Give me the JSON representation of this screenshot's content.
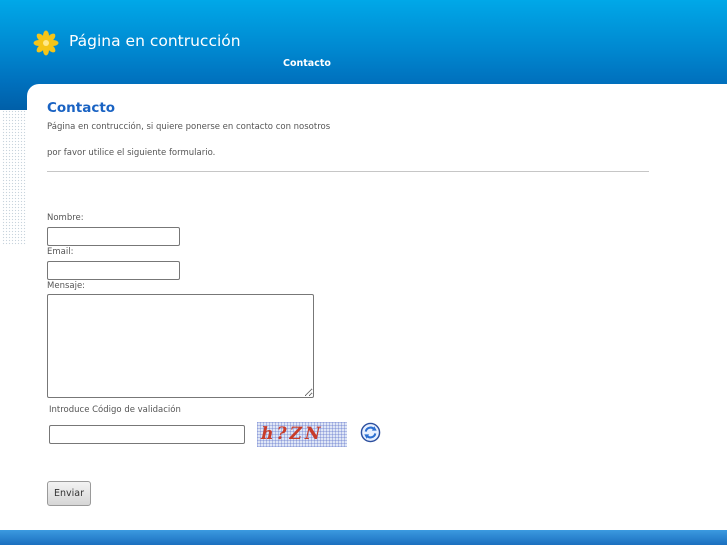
{
  "site": {
    "title": "Página en contrucción"
  },
  "nav": {
    "items": [
      {
        "label": "Contacto"
      }
    ]
  },
  "page": {
    "heading": "Contacto",
    "intro_line1": "Página en contrucción, si quiere ponerse en contacto con nosotros",
    "intro_line2": "por favor utilice el siguiente formulario."
  },
  "form": {
    "name_label": "Nombre:",
    "name_value": "",
    "email_label": "Email:",
    "email_value": "",
    "message_label": "Mensaje:",
    "message_value": "",
    "captcha_label": "Introduce Código de validación",
    "captcha_value": "",
    "captcha_text": "h?ZN",
    "refresh_icon": "refresh-icon",
    "submit_label": "Enviar"
  },
  "colors": {
    "header_top": "#00a8e8",
    "header_bottom": "#005fa8",
    "heading": "#1a63c3",
    "logo": "#f5c518"
  }
}
